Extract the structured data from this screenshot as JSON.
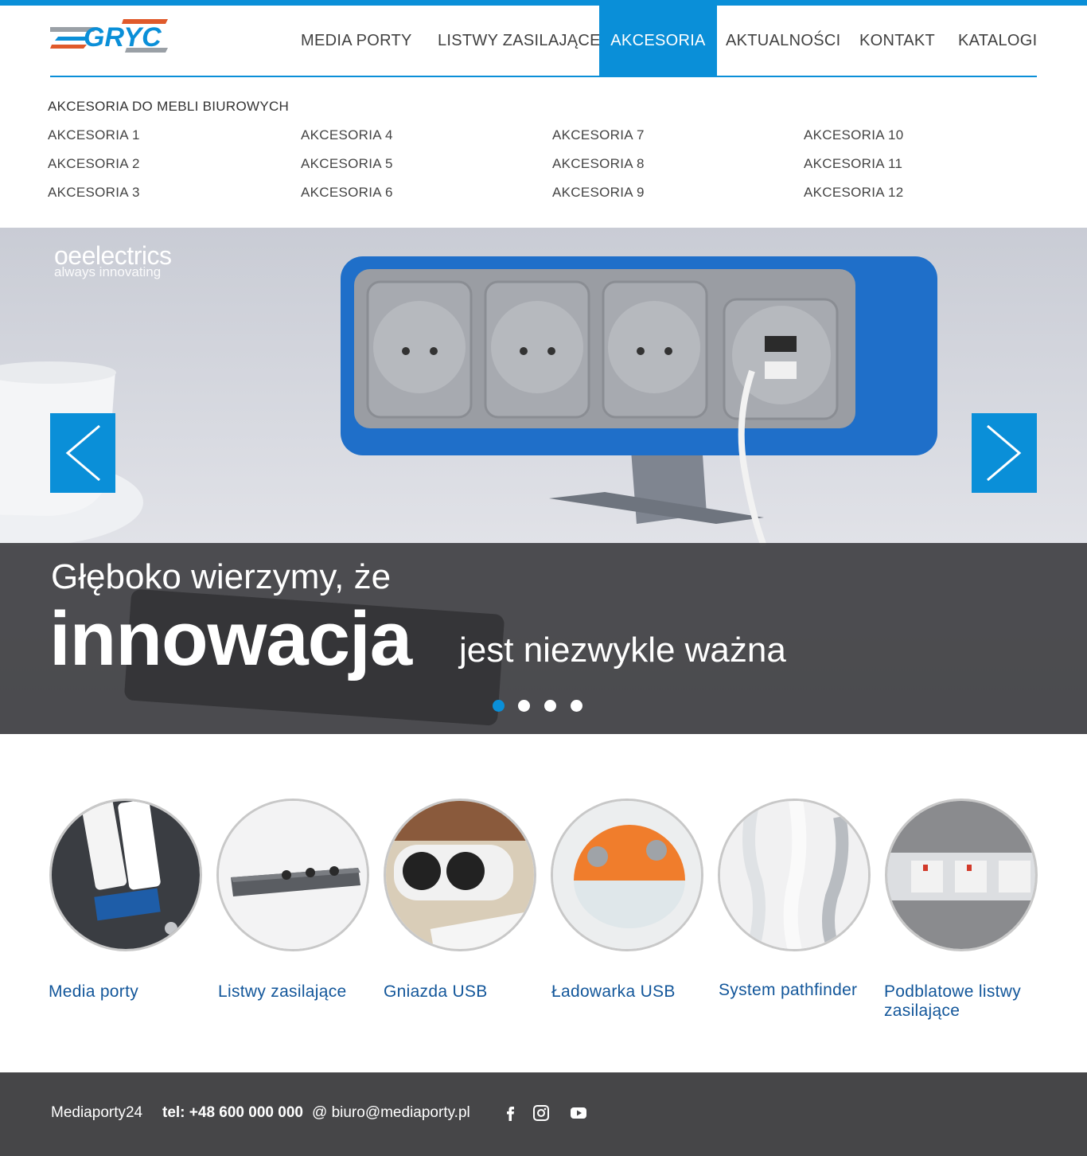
{
  "header": {
    "logo_text": "GRYC",
    "nav": [
      {
        "label": "MEDIA PORTY",
        "active": false
      },
      {
        "label": "LISTWY ZASILAJĄCE",
        "active": false
      },
      {
        "label": "AKCESORIA",
        "active": true
      },
      {
        "label": "AKTUALNOŚCI",
        "active": false
      },
      {
        "label": "KONTAKT",
        "active": false
      },
      {
        "label": "KATALOGI",
        "active": false
      }
    ]
  },
  "mega_menu": {
    "title": "AKCESORIA DO MEBLI BIUROWYCH",
    "items": [
      "AKCESORIA 1",
      "AKCESORIA 2",
      "AKCESORIA 3",
      "AKCESORIA 4",
      "AKCESORIA 5",
      "AKCESORIA 6",
      "AKCESORIA 7",
      "AKCESORIA 8",
      "AKCESORIA 9",
      "AKCESORIA 10",
      "AKCESORIA 11",
      "AKCESORIA 12"
    ]
  },
  "hero": {
    "brand": "oeelectrics",
    "brand_tagline": "always innovating",
    "caption_line1": "Głęboko wierzymy, że",
    "caption_emphasis": "innowacja",
    "caption_line2": "jest niezwykle ważna",
    "slides_total": 4,
    "active_slide": 1,
    "prev_icon": "chevron-left-icon",
    "next_icon": "chevron-right-icon"
  },
  "categories": [
    {
      "label": "Media porty"
    },
    {
      "label": "Listwy zasilające"
    },
    {
      "label": "Gniazda USB"
    },
    {
      "label": "Ładowarka USB"
    },
    {
      "label": "System pathfinder"
    },
    {
      "label": "Podblatowe listwy zasilające"
    }
  ],
  "footer": {
    "site": "Mediaporty24",
    "phone": "tel: +48 600 000 000",
    "email": "@ biuro@mediaporty.pl",
    "social_icons": [
      "facebook-icon",
      "instagram-icon",
      "youtube-icon"
    ]
  },
  "colors": {
    "accent": "#0a8fd8",
    "link": "#12569a",
    "footer_bg": "#464648",
    "text": "#404040"
  }
}
